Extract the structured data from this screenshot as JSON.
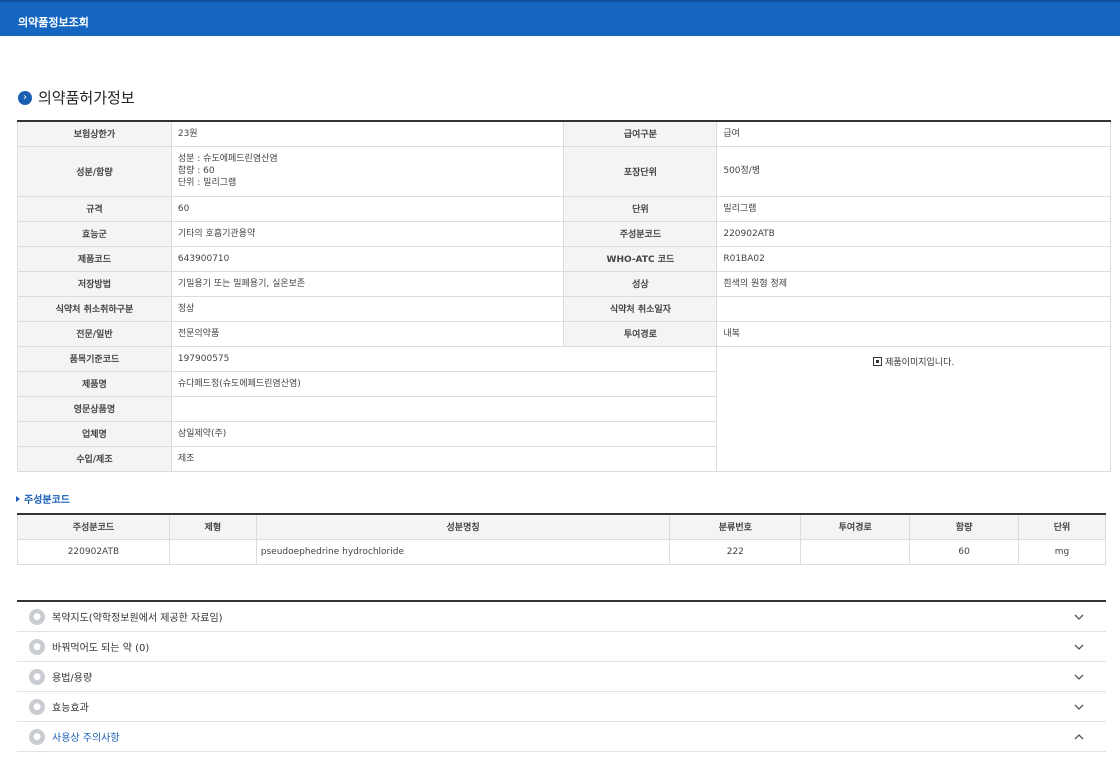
{
  "header": {
    "title": "의약품정보조회"
  },
  "section": {
    "title": "의약품허가정보",
    "bullet": "›"
  },
  "info": {
    "insurance_price_label": "보험상한가",
    "insurance_price": "23원",
    "benefit_label": "급여구분",
    "benefit": "급여",
    "ingredient_label": "성분/함량",
    "ingredient_line1": "성분 : 슈도에페드린염산염",
    "ingredient_line2": "함량 : 60",
    "ingredient_line3": "단위 : 밀리그램",
    "package_label": "포장단위",
    "package": "500정/병",
    "spec_label": "규격",
    "spec": "60",
    "unit_label": "단위",
    "unit": "밀리그램",
    "efficacy_group_label": "효능군",
    "efficacy_group": "기타의 호흡기관용약",
    "main_code_label": "주성분코드",
    "main_code": "220902ATB",
    "product_code_label": "제품코드",
    "product_code": "643900710",
    "atc_label": "WHO-ATC 코드",
    "atc": "R01BA02",
    "storage_label": "저장방법",
    "storage": "기밀용기 또는 밀폐용기, 실온보존",
    "appearance_label": "성상",
    "appearance": "흰색의 원형 정제",
    "mfds_cancel_label": "식약처 취소취하구분",
    "mfds_cancel": "정상",
    "mfds_cancel_date_label": "식약처 취소일자",
    "mfds_cancel_date": "",
    "otc_label": "전문/일반",
    "otc": "전문의약품",
    "route_label": "투여경로",
    "route": "내복",
    "std_code_label": "품목기준코드",
    "std_code": "197900575",
    "image_text": "제품이미지입니다.",
    "product_name_label": "제품명",
    "product_name": "슈다페드정(슈도에페드린염산염)",
    "english_name_label": "영문상품명",
    "english_name": "",
    "company_label": "업체명",
    "company": "삼일제약(주)",
    "import_label": "수입/제조",
    "import": "제조"
  },
  "component": {
    "title": "주성분코드",
    "headers": [
      "주성분코드",
      "제형",
      "성분명칭",
      "분류번호",
      "투여경로",
      "함량",
      "단위"
    ],
    "row": [
      "220902ATB",
      "",
      "pseudoephedrine hydrochloride",
      "222",
      "",
      "60",
      "mg"
    ]
  },
  "accordion": {
    "items": [
      {
        "label": "복약지도(약학정보원에서 제공한 자료임)",
        "state": "collapsed"
      },
      {
        "label": "바꿔먹어도 되는 약 (0)",
        "state": "collapsed"
      },
      {
        "label": "용법/용량",
        "state": "collapsed"
      },
      {
        "label": "효능효과",
        "state": "collapsed"
      },
      {
        "label": "사용상 주의사항",
        "state": "expanded"
      }
    ],
    "active_color": "#1a5fb4"
  },
  "colors": {
    "header_bg": "#1566c0",
    "accent": "#1a5fb4"
  },
  "icons": {
    "bullet": "circle-arrow-icon",
    "image": "image-icon",
    "chevron_down": "chevron-down-icon",
    "chevron_up": "chevron-up-icon",
    "pill": "pill-icon"
  }
}
